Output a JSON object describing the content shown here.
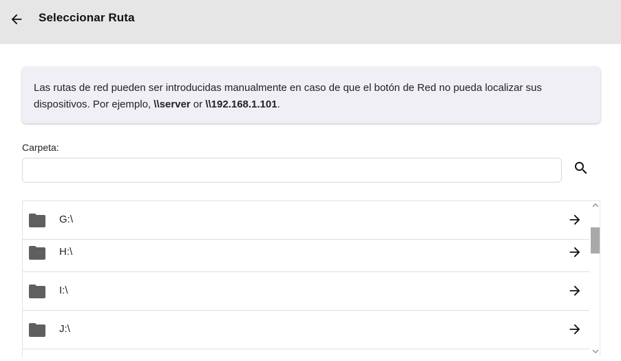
{
  "header": {
    "title": "Seleccionar Ruta",
    "back_icon": "arrow-left-icon"
  },
  "info": {
    "text_prefix": "Las rutas de red pueden ser introducidas manualmente en caso de que el botón de Red no pueda localizar sus dispositivos. Por ejemplo, ",
    "example_server": "\\\\server",
    "or_text": " or ",
    "example_ip": "\\\\192.168.1.101",
    "suffix": "."
  },
  "folder": {
    "label": "Carpeta:",
    "value": "",
    "search_icon": "search-icon"
  },
  "list": {
    "items": [
      {
        "label": "G:\\",
        "icon": "folder-icon",
        "action_icon": "arrow-right-icon"
      },
      {
        "label": "H:\\",
        "icon": "folder-icon",
        "action_icon": "arrow-right-icon"
      },
      {
        "label": "I:\\",
        "icon": "folder-icon",
        "action_icon": "arrow-right-icon"
      },
      {
        "label": "J:\\",
        "icon": "folder-icon",
        "action_icon": "arrow-right-icon"
      }
    ]
  },
  "colors": {
    "header_bg": "#e6e6e6",
    "info_bg": "#efeff5",
    "icon_gray": "#5f5f5f"
  }
}
